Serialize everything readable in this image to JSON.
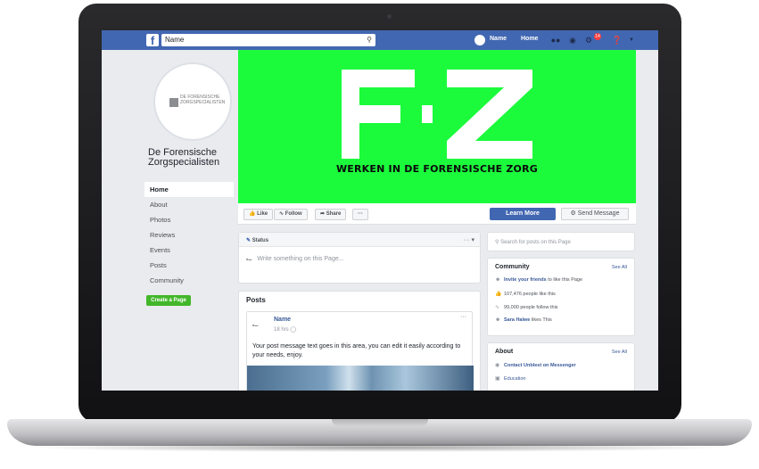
{
  "topbar": {
    "logo": "f",
    "search_value": "Name",
    "profile_name": "Name",
    "home_label": "Home",
    "notification_count": "14"
  },
  "page": {
    "name": "De Forensische Zorgspecialisten",
    "logo_text": "DE FORENSISCHE ZORGSPECIALISTEN"
  },
  "left_nav": {
    "items": [
      "Home",
      "About",
      "Photos",
      "Reviews",
      "Events",
      "Posts",
      "Community"
    ],
    "create_page": "Create a Page"
  },
  "cover": {
    "letters": "FZ",
    "tagline": "WERKEN IN DE FORENSISCHE ZORG",
    "background_color": "#1bfb3c"
  },
  "actions": {
    "like": "Like",
    "follow": "Follow",
    "share": "Share",
    "more": "···",
    "learn_more": "Learn More",
    "send_message": "Send Message"
  },
  "status": {
    "header": "Status",
    "placeholder": "Write something on this Page..."
  },
  "posts": {
    "title": "Posts",
    "author": "Name",
    "time": "18 hrs",
    "body": "Your post message text goes in this area, you can edit it easily according to your needs, enjoy."
  },
  "sidebar": {
    "search_placeholder": "Search for posts on this Page",
    "community": {
      "title": "Community",
      "see_all": "See All",
      "invite_link": "Invite your friends",
      "invite_rest": " to like this Page",
      "likes": "107,476 people like this",
      "follows": "99,000 people follow this",
      "friend_name": "Sara Halwe",
      "friend_rest": " likes This"
    },
    "about": {
      "title": "About",
      "see_all": "See All",
      "messenger": "Contact Unblest on Messenger",
      "category": "Education"
    }
  }
}
